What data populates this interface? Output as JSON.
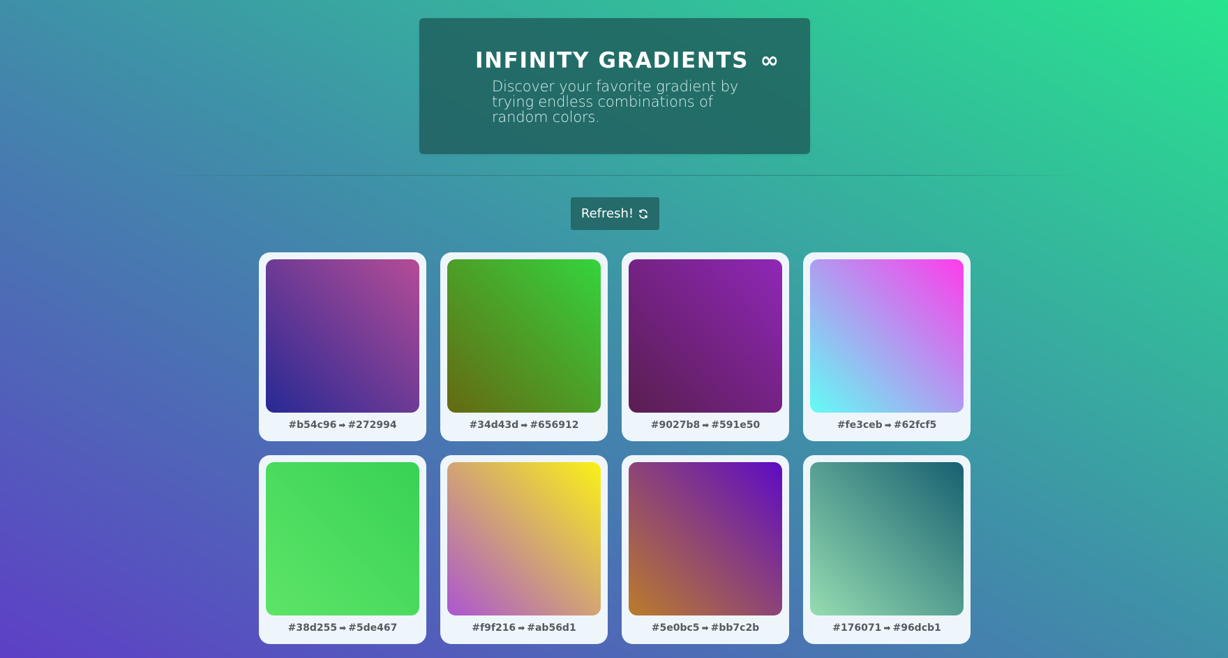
{
  "header": {
    "title": "INFINITY GRADIENTS",
    "title_icon": "∞",
    "subtitle": "Discover your favorite gradient by trying endless combinations of random colors."
  },
  "refresh_button": {
    "label": "Refresh!",
    "icon": "refresh-icon"
  },
  "gradients": [
    {
      "from": "#b54c96",
      "to": "#272994",
      "arrow": "➡"
    },
    {
      "from": "#34d43d",
      "to": "#656912",
      "arrow": "➡"
    },
    {
      "from": "#9027b8",
      "to": "#591e50",
      "arrow": "➡"
    },
    {
      "from": "#fe3ceb",
      "to": "#62fcf5",
      "arrow": "➡"
    },
    {
      "from": "#38d255",
      "to": "#5de467",
      "arrow": "➡"
    },
    {
      "from": "#f9f216",
      "to": "#ab56d1",
      "arrow": "➡"
    },
    {
      "from": "#5e0bc5",
      "to": "#bb7c2b",
      "arrow": "➡"
    },
    {
      "from": "#176071",
      "to": "#96dcb1",
      "arrow": "➡"
    }
  ]
}
